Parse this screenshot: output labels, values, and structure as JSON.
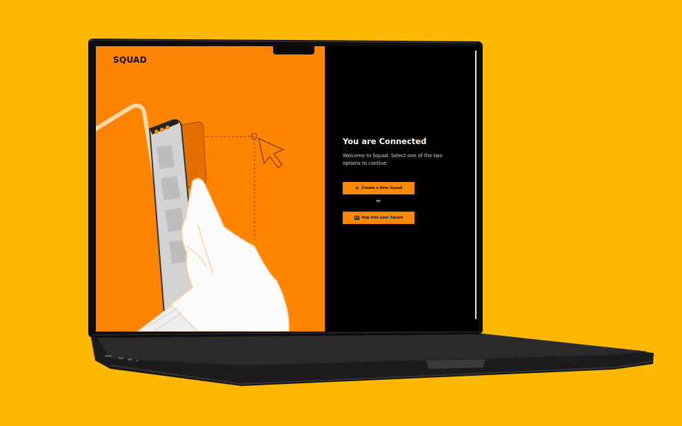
{
  "colors": {
    "background": "#FFB800",
    "accent": "#FF8A00",
    "left_panel": "#FF8400",
    "right_panel": "#000000"
  },
  "app": {
    "brand": "SQUAD"
  },
  "connect": {
    "title": "You are Connected",
    "check_icon": "checkmark-icon",
    "welcome_text": "Welcome to Squad. Select one of the two options to contiue.",
    "create_button_label": "Create a New Squad",
    "create_button_icon": "plus-icon",
    "or_text": "or",
    "hop_button_label": "Hop into your Squad",
    "hop_button_icon": "grid-icon"
  }
}
